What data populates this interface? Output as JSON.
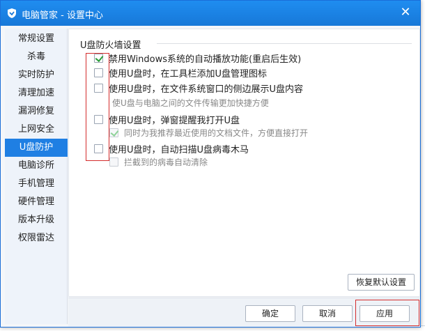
{
  "window": {
    "title": "电脑管家 - 设置中心",
    "close_glyph": "✕"
  },
  "sidebar": {
    "items": [
      {
        "label": "常规设置",
        "active": false
      },
      {
        "label": "杀毒",
        "active": false
      },
      {
        "label": "实时防护",
        "active": false
      },
      {
        "label": "清理加速",
        "active": false
      },
      {
        "label": "漏洞修复",
        "active": false
      },
      {
        "label": "上网安全",
        "active": false
      },
      {
        "label": "U盘防护",
        "active": true
      },
      {
        "label": "电脑诊所",
        "active": false
      },
      {
        "label": "手机管理",
        "active": false
      },
      {
        "label": "硬件管理",
        "active": false
      },
      {
        "label": "版本升级",
        "active": false
      },
      {
        "label": "权限雷达",
        "active": false
      }
    ]
  },
  "content": {
    "section_title": "U盘防火墙设置",
    "options": [
      {
        "label": "禁用Windows系统的自动播放功能(重启后生效)",
        "checked": true
      },
      {
        "label": "使用U盘时，在工具栏添加U盘管理图标",
        "checked": false
      },
      {
        "label": "使用U盘时，在文件系统窗口的侧边展示U盘内容",
        "checked": false
      },
      {
        "label": "使用U盘时，弹窗提醒我打开U盘",
        "checked": false
      },
      {
        "label": "使用U盘时，自动扫描U盘病毒木马",
        "checked": false
      }
    ],
    "hint_side": "使U盘与电脑之间的文件传输更加快捷方便",
    "sub_recent": {
      "label": "同时为我推荐最近使用的文档文件，方便直接打开",
      "checked": true
    },
    "sub_block": {
      "label": "拦截到的病毒自动清除",
      "checked": false
    },
    "restore_default": "恢复默认设置"
  },
  "footer": {
    "ok": "确定",
    "cancel": "取消",
    "apply": "应用"
  },
  "colors": {
    "titlebar": "#1778d8",
    "active_nav": "#1f7fe3",
    "highlight_box": "#d42b2b",
    "check_green": "#2a9d3a"
  }
}
